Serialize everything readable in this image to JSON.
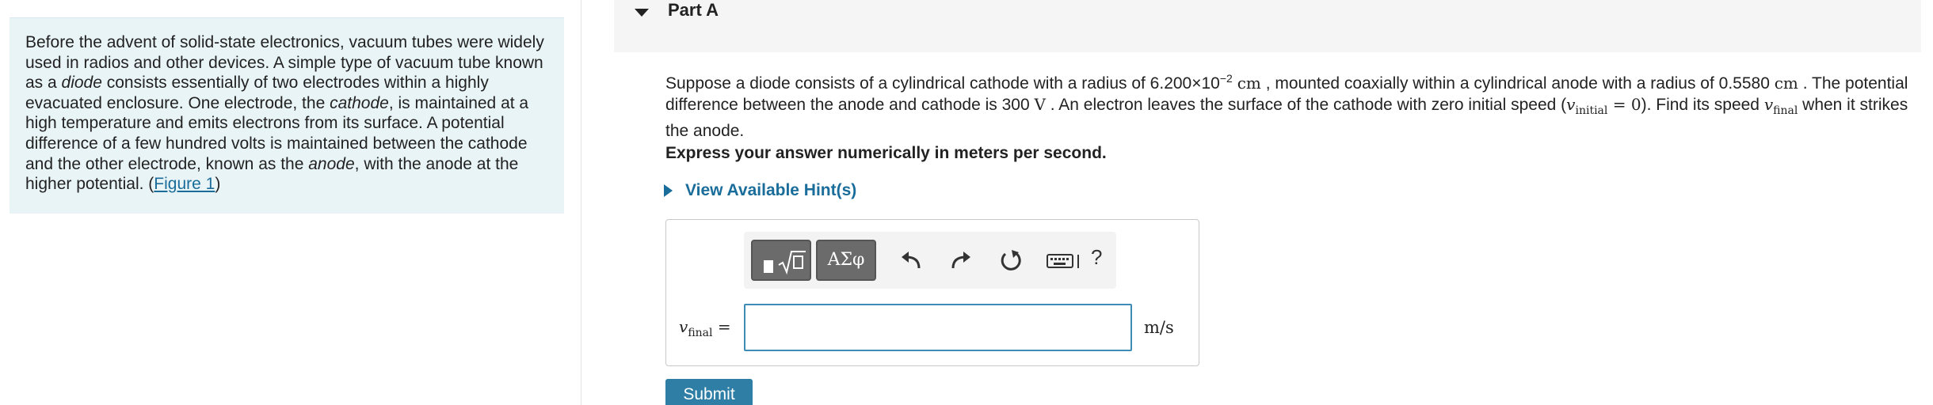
{
  "intro": {
    "t1": "Before the advent of solid-state electronics, vacuum tubes were widely used in radios and other devices. A simple type of vacuum tube known as a ",
    "diode": "diode",
    "t2": " consists essentially of two electrodes within a highly evacuated enclosure. One electrode, the ",
    "cathode": "cathode",
    "t3": ", is maintained at a high temperature and emits electrons from its surface. A potential difference of a few hundred volts is maintained between the cathode and the other electrode, known as the ",
    "anode": "anode",
    "t4": ", with the anode at the higher potential. (",
    "figure_link": "Figure 1",
    "t5": ")"
  },
  "part": {
    "title": "Part A"
  },
  "problem": {
    "p1": "Suppose a diode consists of a cylindrical cathode with a radius of 6.200×10",
    "exp": "−2",
    "unit_cm1": "cm",
    "p2": " , mounted coaxially within a cylindrical anode with a radius of 0.5580 ",
    "unit_cm2": "cm",
    "p3": " . The potential difference between the anode and cathode is 300 ",
    "unit_v": "V",
    "p4": " . An electron leaves the surface of the cathode with zero initial speed (",
    "v": "v",
    "sub_initial": "initial",
    "eq_zero": " = 0",
    "p5": "). Find its speed ",
    "sub_final": "final",
    "p6": " when it strikes the anode."
  },
  "instruction": "Express your answer numerically in meters per second.",
  "hints": {
    "label": "View Available Hint(s)"
  },
  "answer": {
    "toolbar": {
      "greek_label": "ΑΣφ",
      "help_label": "?"
    },
    "variable": "v",
    "variable_sub": "final",
    "equals": " =",
    "value": "",
    "unit": "m/s"
  },
  "submit_label": "Submit",
  "colors": {
    "link": "#1a6d9a",
    "submit": "#2e7ea6",
    "intro_bg": "#e9f4f7",
    "input_border": "#3d8cb5"
  }
}
